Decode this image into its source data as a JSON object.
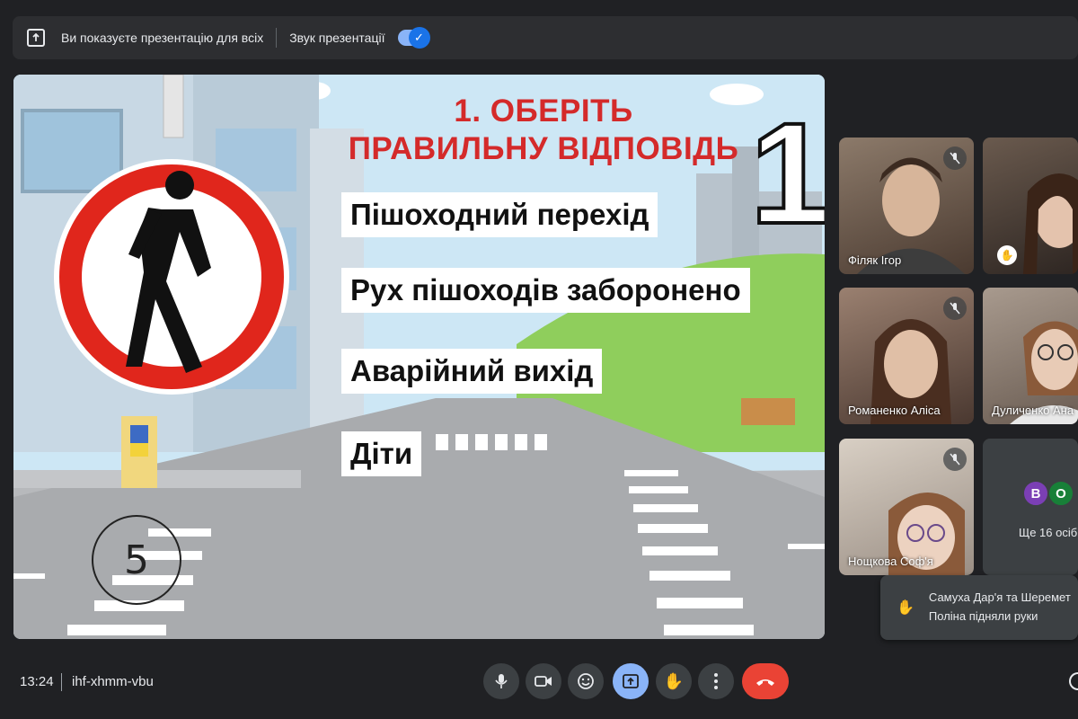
{
  "top_bar": {
    "presenting_text": "Ви показуєте презентацію для всіх",
    "audio_label": "Звук презентації",
    "audio_toggle_on": true
  },
  "slide": {
    "title_line1": "1. ОБЕРІТЬ",
    "title_line2": "ПРАВИЛЬНУ ВІДПОВІДЬ",
    "question_number": "1",
    "answers": [
      "Пішоходний перехід",
      "Рух пішоходів заборонено",
      "Аварійний вихід",
      "Діти"
    ],
    "timer": "5"
  },
  "participants": [
    {
      "name": "Філяк Ігор",
      "muted": true
    },
    {
      "name": "",
      "muted": false
    },
    {
      "name": "Романенко Аліса",
      "muted": true
    },
    {
      "name": "Дуличенко Ана",
      "muted": false
    },
    {
      "name": "Нощкова Соф'я",
      "muted": true
    }
  ],
  "more_tile": {
    "avatars": [
      {
        "letter": "В",
        "color": "#7b3fb5"
      },
      {
        "letter": "О",
        "color": "#188038"
      }
    ],
    "text": "Ще 16 осіб"
  },
  "toast": {
    "text_line1": "Самуха Дар'я та Шеремет",
    "text_line2": "Поліна підняли руки"
  },
  "bottom_bar": {
    "time": "13:24",
    "meeting_code": "ihf-xhmm-vbu"
  },
  "colors": {
    "accent": "#8ab4f8",
    "end_call": "#ea4335",
    "title_red": "#d42a2a",
    "sign_red": "#e0261c"
  }
}
